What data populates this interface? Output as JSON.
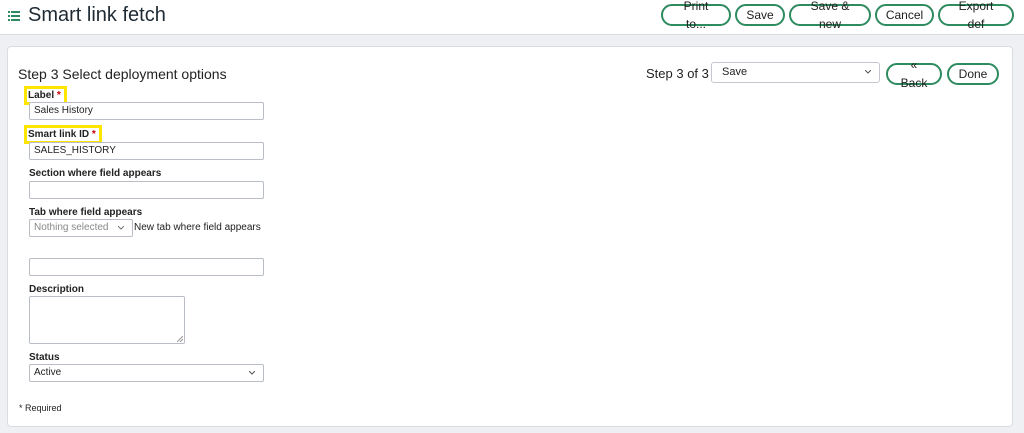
{
  "header": {
    "title": "Smart link fetch",
    "actions": [
      "Print to...",
      "Save",
      "Save & new",
      "Cancel",
      "Export def"
    ]
  },
  "step": {
    "title": "Step 3 Select deployment options",
    "count": "Step 3 of 3",
    "select_value": "Save",
    "back_label": "« Back",
    "done_label": "Done"
  },
  "form": {
    "label": {
      "label": "Label",
      "required": "*",
      "value": "Sales History"
    },
    "smart_link_id": {
      "label": "Smart link ID",
      "required": "*",
      "value": "SALES_HISTORY"
    },
    "section": {
      "label": "Section where field appears",
      "value": ""
    },
    "tab": {
      "label": "Tab where field appears",
      "select_placeholder": "Nothing selected",
      "new_tab_label": "New tab where field appears",
      "new_tab_value": ""
    },
    "description": {
      "label": "Description"
    },
    "status": {
      "label": "Status",
      "value": "Active"
    }
  },
  "footer": {
    "required_note": "* Required"
  },
  "colors": {
    "accent": "#2e8a5f",
    "highlight": "#ffe600",
    "required": "#cc0000"
  },
  "icons": {
    "menu": "list-icon",
    "dropdown": "chevron-down-icon"
  }
}
